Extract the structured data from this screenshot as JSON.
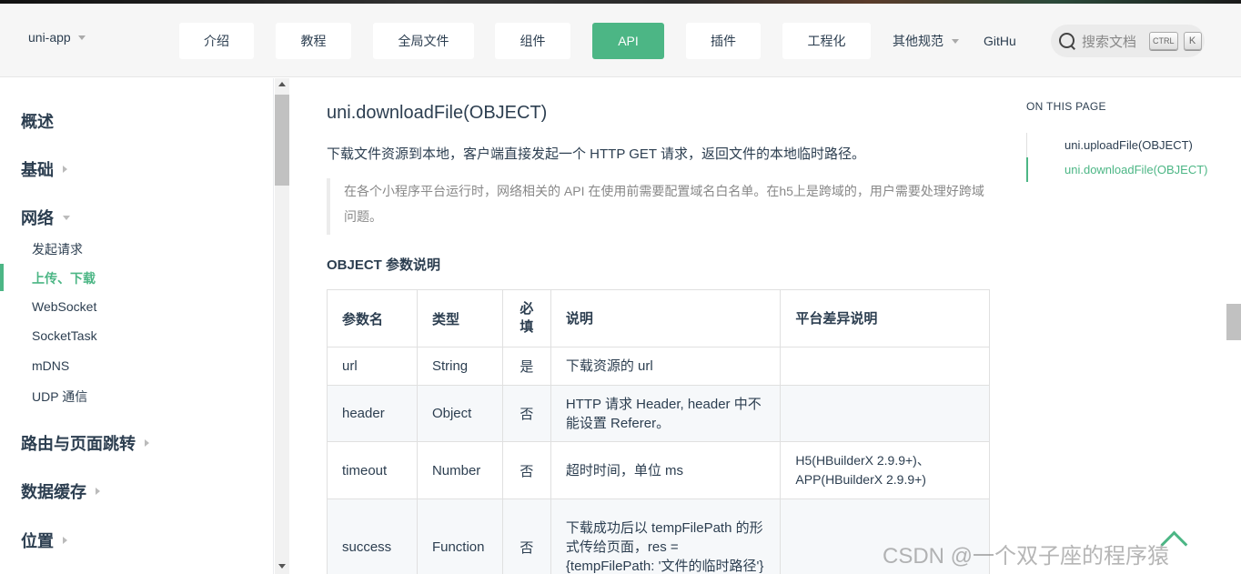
{
  "brand": {
    "name": "uni-app"
  },
  "nav": {
    "items": [
      "介绍",
      "教程",
      "全局文件",
      "组件",
      "API",
      "插件",
      "工程化"
    ],
    "active": "API",
    "more_label": "其他规范",
    "github_label": "GitHu"
  },
  "search": {
    "placeholder": "搜索文档",
    "kbd_ctrl": "CTRL",
    "kbd_k": "K"
  },
  "sidebar": {
    "groups": [
      "概述",
      "基础",
      "网络",
      "路由与页面跳转",
      "数据缓存",
      "位置"
    ],
    "network_items": [
      "发起请求",
      "上传、下载",
      "WebSocket",
      "SocketTask",
      "mDNS",
      "UDP 通信"
    ],
    "active_item": "上传、下载"
  },
  "main": {
    "title": "uni.downloadFile(OBJECT)",
    "description": "下载文件资源到本地，客户端直接发起一个 HTTP GET 请求，返回文件的本地临时路径。",
    "note": "在各个小程序平台运行时，网络相关的 API 在使用前需要配置域名白名单。在h5上是跨域的，用户需要处理好跨域问题。",
    "params_title": "OBJECT 参数说明",
    "table": {
      "headers": [
        "参数名",
        "类型",
        "必填",
        "说明",
        "平台差异说明"
      ],
      "rows": [
        [
          "url",
          "String",
          "是",
          "下载资源的 url",
          ""
        ],
        [
          "header",
          "Object",
          "否",
          "HTTP 请求 Header, header 中不能设置 Referer。",
          ""
        ],
        [
          "timeout",
          "Number",
          "否",
          "超时时间，单位 ms",
          "H5(HBuilderX 2.9.9+)、APP(HBuilderX 2.9.9+)"
        ],
        [
          "success",
          "Function",
          "否",
          "下载成功后以 tempFilePath 的形式传给页面，res = {tempFilePath: '文件的临时路径'}",
          ""
        ]
      ]
    }
  },
  "toc": {
    "heading": "ON THIS PAGE",
    "items": [
      "uni.uploadFile(OBJECT)",
      "uni.downloadFile(OBJECT)"
    ],
    "active": "uni.downloadFile(OBJECT)"
  },
  "watermark": "CSDN @一个双子座的程序猿",
  "colors": {
    "accent": "#4cb685",
    "text": "#2c3e50",
    "muted": "#888888"
  }
}
